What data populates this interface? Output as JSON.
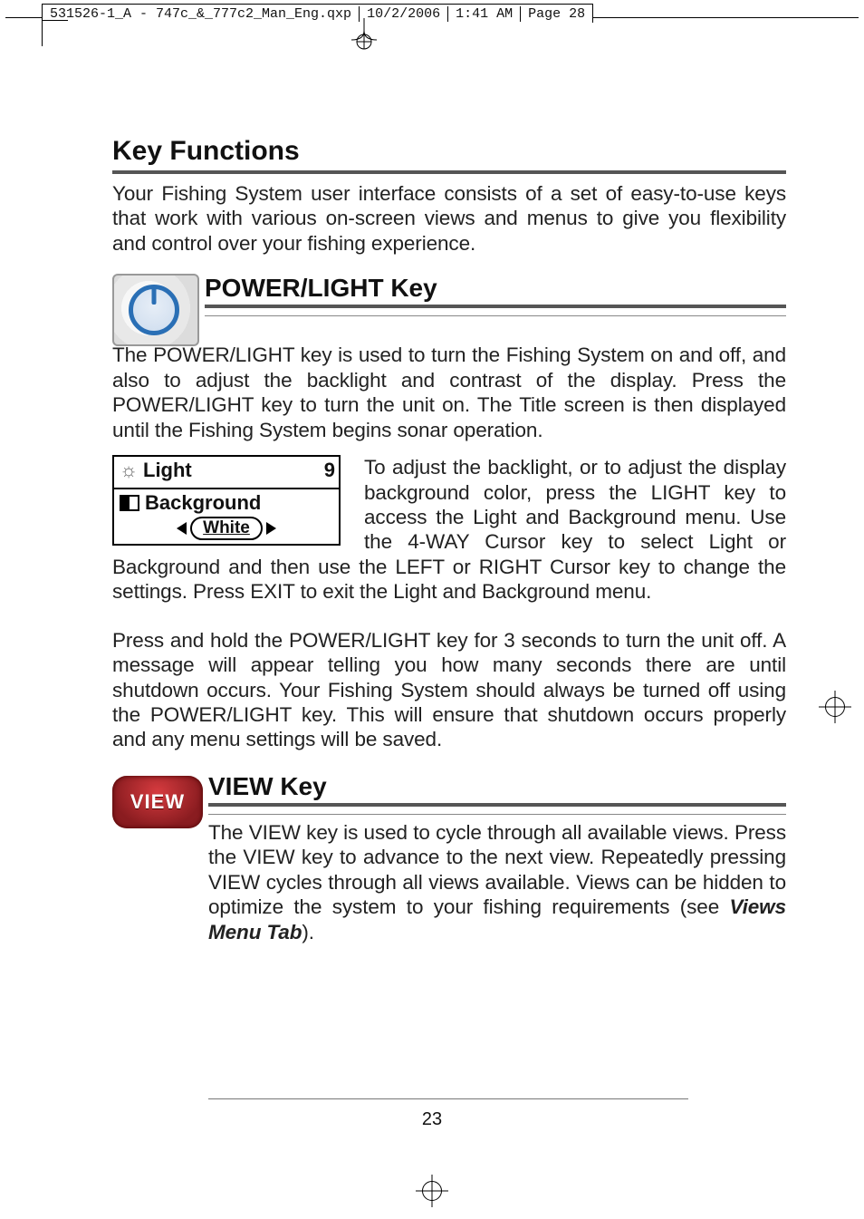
{
  "header": {
    "filename": "531526-1_A - 747c_&_777c2_Man_Eng.qxp",
    "date": "10/2/2006",
    "time": "1:41 AM",
    "page": "Page 28"
  },
  "h_key_functions": "Key Functions",
  "p_intro": "Your Fishing System user interface consists of a set of easy-to-use keys that work with various on-screen views and menus to give you flexibility and control over your fishing experience.",
  "h_power": "POWER/LIGHT Key",
  "p_power1": "The POWER/LIGHT key is used to turn the Fishing System on and off, and also to adjust the backlight and contrast of the display. Press the POWER/LIGHT key to turn the unit on. The Title screen is then displayed until the Fishing System begins sonar operation.",
  "light_menu": {
    "light_label": "Light",
    "light_value": "9",
    "bg_label": "Background",
    "bg_value": "White"
  },
  "p_power2": "To adjust the backlight, or to adjust the display background color, press the LIGHT key to access the Light and Background menu. Use the 4-WAY Cursor key to select Light or Background and then use the LEFT or RIGHT Cursor key to change the settings. Press EXIT to exit the Light and Background menu.",
  "p_power3": "Press and hold the POWER/LIGHT key for 3 seconds to turn the unit off. A message will appear telling you how many seconds there are until shutdown occurs. Your Fishing System should always be turned off using the POWER/LIGHT key. This will ensure that shutdown occurs properly and any menu settings will be saved.",
  "h_view": "VIEW Key",
  "view_btn": "VIEW",
  "p_view_a": "The VIEW key is used to cycle through all available views. Press the VIEW key to advance to the next view. Repeatedly pressing VIEW cycles through all views available. Views can be hidden to optimize the system to your fishing requirements (see ",
  "p_view_ref": "Views Menu Tab",
  "p_view_b": ").",
  "page_number": "23"
}
